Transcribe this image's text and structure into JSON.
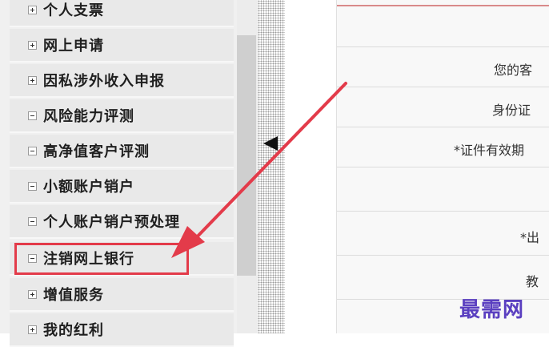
{
  "menu": {
    "items": [
      {
        "label": "个人支票",
        "sign": "plus"
      },
      {
        "label": "网上申请",
        "sign": "plus"
      },
      {
        "label": "因私涉外收入申报",
        "sign": "plus"
      },
      {
        "label": "风险能力评测",
        "sign": "minus"
      },
      {
        "label": "高净值客户评测",
        "sign": "minus"
      },
      {
        "label": "小额账户销户",
        "sign": "minus"
      },
      {
        "label": "个人账户销户预处理",
        "sign": "minus"
      },
      {
        "label": "注销网上银行",
        "sign": "minus"
      },
      {
        "label": "增值服务",
        "sign": "plus"
      },
      {
        "label": "我的红利",
        "sign": "plus"
      }
    ]
  },
  "form": {
    "labels": {
      "customer": "您的客",
      "id": "身份证",
      "id_valid": "*证件有效期",
      "birth": "*出",
      "edu": "教"
    }
  },
  "annotation": {
    "highlight_color": "#e33b4a"
  },
  "watermark": {
    "text": "最需网"
  }
}
